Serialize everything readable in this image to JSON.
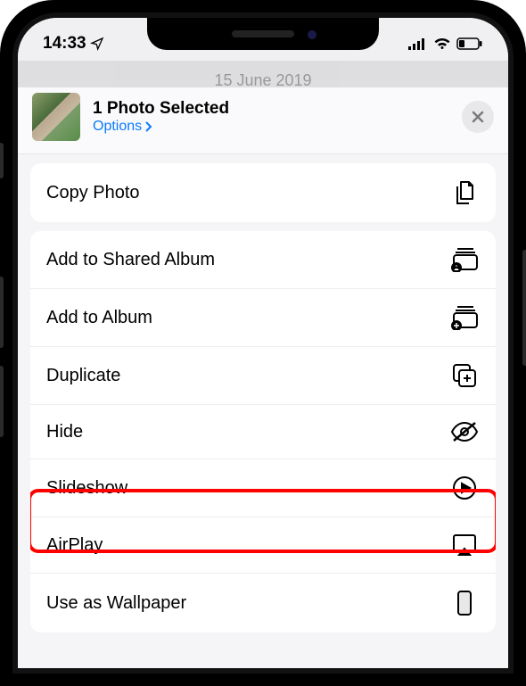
{
  "status": {
    "time": "14:33"
  },
  "nav": {
    "peek": "15 June 2019"
  },
  "sheet": {
    "title": "1 Photo Selected",
    "options_label": "Options"
  },
  "actions": {
    "copy_photo": "Copy Photo",
    "add_shared_album": "Add to Shared Album",
    "add_album": "Add to Album",
    "duplicate": "Duplicate",
    "hide": "Hide",
    "slideshow": "Slideshow",
    "airplay": "AirPlay",
    "wallpaper": "Use as Wallpaper"
  }
}
